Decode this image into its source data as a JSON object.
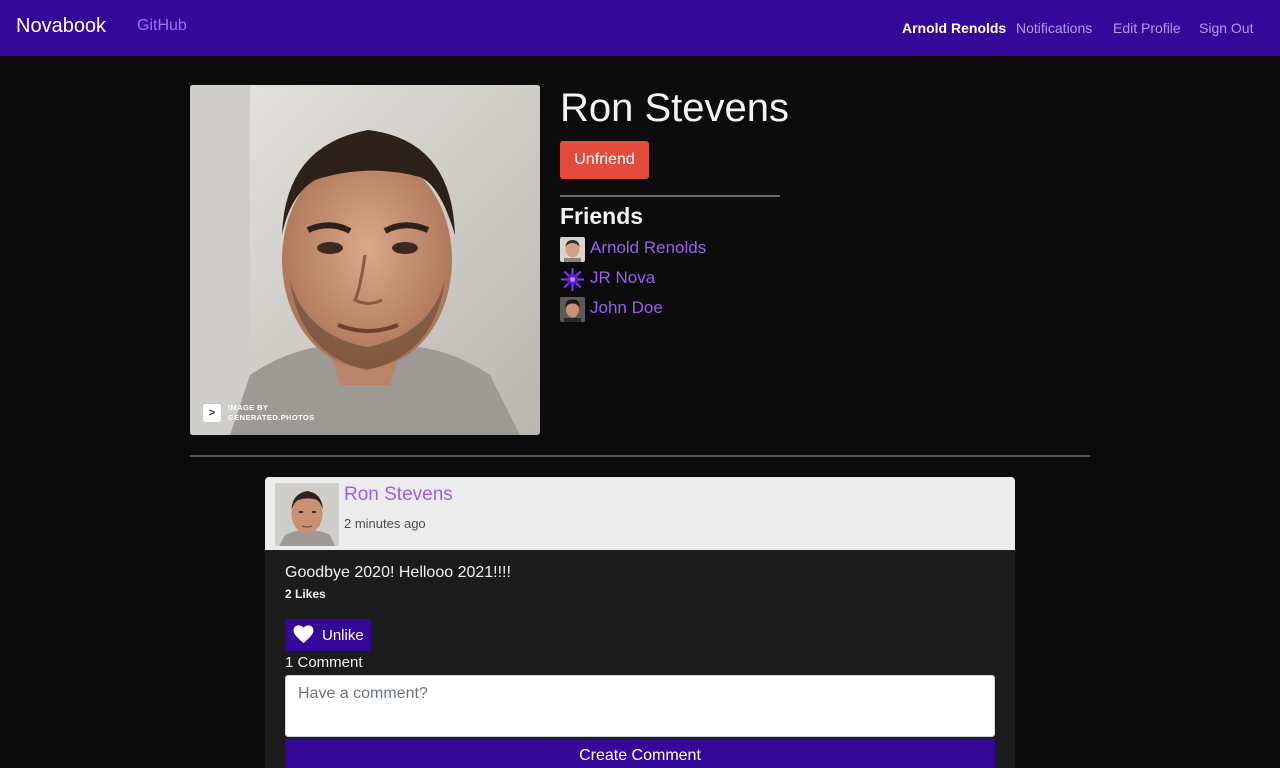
{
  "navbar": {
    "brand": "Novabook",
    "github": "GitHub",
    "current_user": "Arnold Renolds",
    "notifications": "Notifications",
    "edit_profile": "Edit Profile",
    "sign_out": "Sign Out",
    "background_color": "#35089a"
  },
  "profile": {
    "name": "Ron Stevens",
    "unfriend_label": "Unfriend",
    "unfriend_color": "#e34b3c",
    "photo_watermark": "IMAGE BY\nGENERATED.PHOTOS",
    "friends_heading": "Friends",
    "friends": [
      {
        "name": "Arnold Renolds",
        "avatar_icon": "person-photo"
      },
      {
        "name": "JR Nova",
        "avatar_icon": "purple-starburst-icon"
      },
      {
        "name": "John Doe",
        "avatar_icon": "person-photo"
      }
    ]
  },
  "post": {
    "author": "Ron Stevens",
    "timestamp": "2 minutes ago",
    "body": "Goodbye 2020! Hellooo 2021!!!!",
    "likes": "2 Likes",
    "unlike_label": "Unlike",
    "comment_count": "1 Comment",
    "comment_placeholder": "Have a comment?",
    "create_comment_label": "Create Comment"
  }
}
